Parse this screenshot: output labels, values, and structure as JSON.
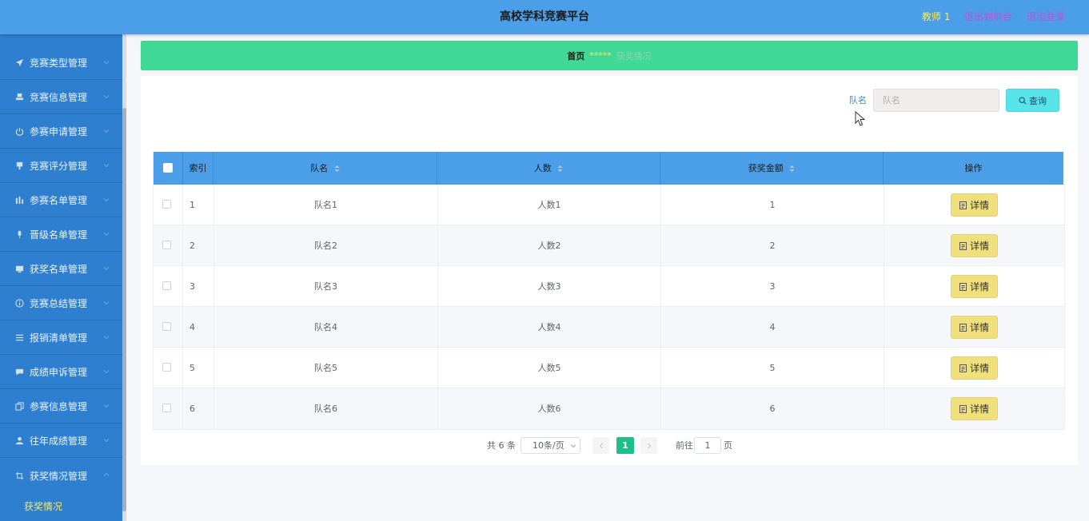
{
  "header": {
    "title": "高校学科竞赛平台",
    "user": "教师 1",
    "back_to_front": "退出到前台",
    "logout": "退出登录"
  },
  "sidebar": {
    "items": [
      {
        "label": "竞赛类型管理",
        "icon": "send-icon"
      },
      {
        "label": "竞赛信息管理",
        "icon": "stamp-icon"
      },
      {
        "label": "参赛申请管理",
        "icon": "power-icon"
      },
      {
        "label": "竞赛评分管理",
        "icon": "stamp-icon"
      },
      {
        "label": "参赛名单管理",
        "icon": "bar-chart-icon"
      },
      {
        "label": "晋级名单管理",
        "icon": "microphone-icon"
      },
      {
        "label": "获奖名单管理",
        "icon": "monitor-icon"
      },
      {
        "label": "竞赛总结管理",
        "icon": "info-icon"
      },
      {
        "label": "报销清单管理",
        "icon": "menu-icon"
      },
      {
        "label": "成绩申诉管理",
        "icon": "chat-icon"
      },
      {
        "label": "参赛信息管理",
        "icon": "copy-icon"
      },
      {
        "label": "往年成绩管理",
        "icon": "user-icon"
      },
      {
        "label": "获奖情况管理",
        "icon": "crop-icon"
      }
    ],
    "sub_item": "获奖情况"
  },
  "breadcrumb": {
    "home": "首页",
    "separator": "*****",
    "current": "获奖情况"
  },
  "search": {
    "label": "队名",
    "placeholder": "队名",
    "button": "查询"
  },
  "table": {
    "columns": [
      "索引",
      "队名",
      "人数",
      "获奖金额",
      "操作"
    ],
    "rows": [
      {
        "index": "1",
        "team": "队名1",
        "people": "人数1",
        "amount": "1"
      },
      {
        "index": "2",
        "team": "队名2",
        "people": "人数2",
        "amount": "2"
      },
      {
        "index": "3",
        "team": "队名3",
        "people": "人数3",
        "amount": "3"
      },
      {
        "index": "4",
        "team": "队名4",
        "people": "人数4",
        "amount": "4"
      },
      {
        "index": "5",
        "team": "队名5",
        "people": "人数5",
        "amount": "5"
      },
      {
        "index": "6",
        "team": "队名6",
        "people": "人数6",
        "amount": "6"
      }
    ],
    "detail_button": "详情"
  },
  "pagination": {
    "total": "共 6 条",
    "page_size": "10条/页",
    "current_page": "1",
    "goto_label": "前往",
    "goto_value": "1",
    "page_suffix": "页"
  },
  "colors": {
    "header": "#4a9fe8",
    "sidebar": "#2f7fd1",
    "breadcrumb": "#3fd995",
    "search_button": "#57e3e8",
    "detail_button": "#efdf7d",
    "active_page": "#1ec088",
    "highlight_text": "#f4e76a",
    "link_text": "#c34fd6"
  }
}
